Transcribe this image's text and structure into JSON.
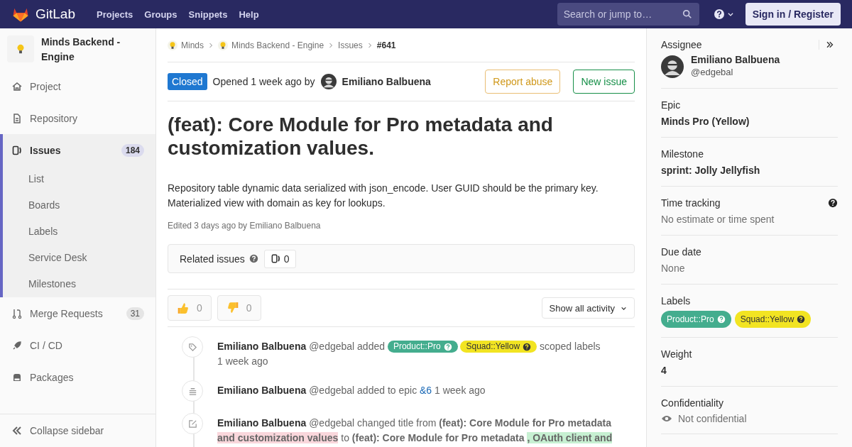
{
  "nav": {
    "logo_text": "GitLab",
    "links": [
      "Projects",
      "Groups",
      "Snippets",
      "Help"
    ],
    "search": {
      "placeholder": "Search or jump to…"
    },
    "sign_in": "Sign in / Register"
  },
  "project": {
    "name": "Minds Backend - Engine"
  },
  "sidebar": {
    "items": [
      {
        "label": "Project",
        "selected": false
      },
      {
        "label": "Repository",
        "selected": false
      },
      {
        "label": "Issues",
        "count": "184",
        "selected": true,
        "expanded": true,
        "children": [
          {
            "label": "List",
            "selected": false
          },
          {
            "label": "Boards",
            "selected": false
          },
          {
            "label": "Labels",
            "selected": false
          },
          {
            "label": "Service Desk",
            "selected": false
          },
          {
            "label": "Milestones",
            "selected": false
          }
        ]
      },
      {
        "label": "Merge Requests",
        "count": "31",
        "selected": false
      },
      {
        "label": "CI / CD",
        "selected": false
      },
      {
        "label": "Packages",
        "selected": false
      }
    ],
    "collapse": "Collapse sidebar"
  },
  "breadcrumbs": [
    {
      "label": "Minds",
      "kind": "group"
    },
    {
      "label": "Minds Backend - Engine",
      "kind": "group"
    },
    {
      "label": "Issues",
      "kind": "link"
    },
    {
      "label": "#641",
      "kind": "current"
    }
  ],
  "issue": {
    "status": "Closed",
    "opened": "Opened 1 week ago by",
    "author": "Emiliano Balbuena",
    "buttons": [
      {
        "label": "Report abuse",
        "kind": "warning"
      },
      {
        "label": "New issue",
        "kind": "success"
      }
    ],
    "title": "(feat): Core Module for Pro metadata and customization values.",
    "description": "Repository table dynamic data serialized with json_encode. User GUID should be the primary key. Materialized view with domain as key for lookups.",
    "edited": "Edited 3 days ago by Emiliano Balbuena"
  },
  "related": {
    "label": "Related issues",
    "count": "0"
  },
  "awards": [
    {
      "kind": "thumbsup",
      "count": "0"
    },
    {
      "kind": "thumbsdown",
      "count": "0"
    }
  ],
  "activity_filter": "Show all activity",
  "notes": [
    {
      "kind": "labels",
      "author": "Emiliano Balbuena",
      "segments": [
        {
          "kind": "text",
          "text": "@edgebal added"
        },
        {
          "kind": "label",
          "text": "Product::Pro",
          "color": "#44ad8e"
        },
        {
          "kind": "label",
          "text": "Squad::Yellow",
          "color": "#f2e422"
        },
        {
          "kind": "text",
          "text": "scoped labels"
        },
        {
          "kind": "time",
          "text": "1 week ago"
        }
      ]
    },
    {
      "kind": "epic",
      "author": "Emiliano Balbuena",
      "segments": [
        {
          "kind": "text",
          "text": "@edgebal added to epic"
        },
        {
          "kind": "link",
          "text": "&6"
        },
        {
          "kind": "time",
          "text": "1 week ago"
        }
      ]
    },
    {
      "kind": "title",
      "author": "Emiliano Balbuena",
      "segments": [
        {
          "kind": "text",
          "text": "@edgebal changed title from"
        },
        {
          "kind": "bold",
          "text": "(feat): Core Module for Pro metadata"
        },
        {
          "kind": "deleted",
          "text": "and customization values"
        },
        {
          "kind": "text",
          "text": "to"
        },
        {
          "kind": "bold",
          "text": "(feat): Core Module for Pro metadata"
        },
        {
          "kind": "added",
          "text": ", OAuth client and"
        }
      ]
    }
  ],
  "right_sidebar": [
    {
      "kind": "user",
      "title": "Assignee",
      "name": "Emiliano Balbuena",
      "handle": "@edgebal"
    },
    {
      "kind": "bold",
      "title": "Epic",
      "value": "Minds Pro (Yellow)"
    },
    {
      "kind": "bold",
      "title": "Milestone",
      "value": "sprint: Jolly Jellyfish"
    },
    {
      "kind": "muted",
      "title": "Time tracking",
      "value": "No estimate or time spent",
      "help": true
    },
    {
      "kind": "muted",
      "title": "Due date",
      "value": "None"
    },
    {
      "kind": "labels",
      "title": "Labels",
      "labels": [
        {
          "text": "Product::Pro",
          "color": "#44ad8e"
        },
        {
          "text": "Squad::Yellow",
          "color": "#f2e422"
        }
      ]
    },
    {
      "kind": "bold",
      "title": "Weight",
      "value": "4"
    },
    {
      "kind": "eye",
      "title": "Confidentiality",
      "value": "Not confidential"
    }
  ]
}
